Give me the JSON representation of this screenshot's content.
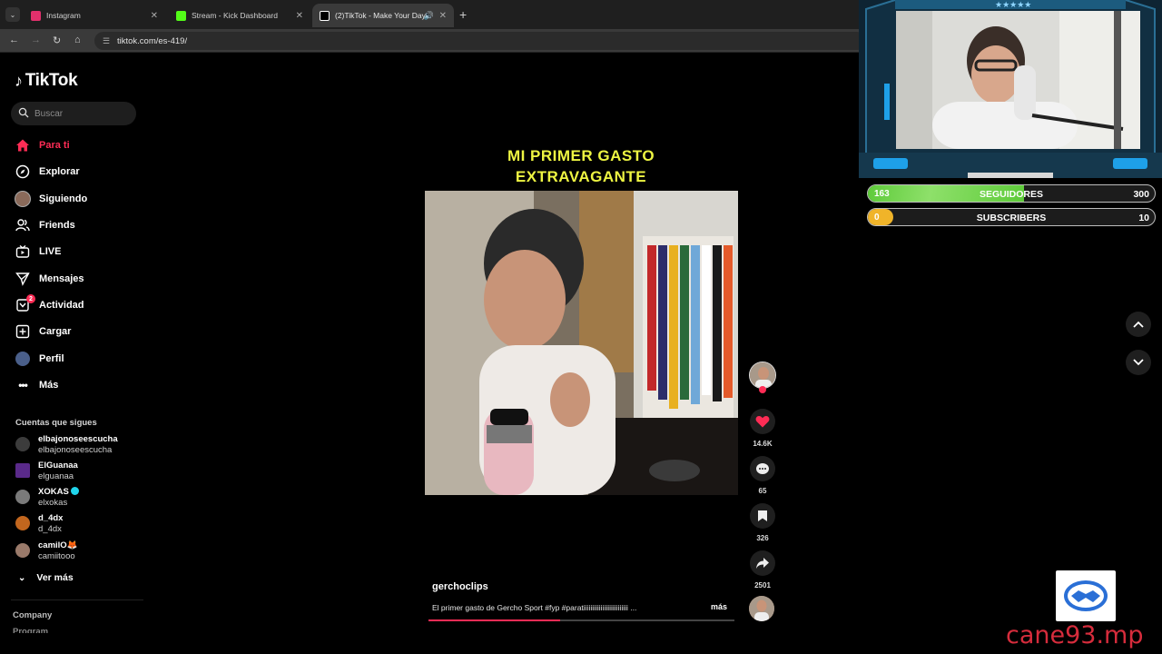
{
  "browser": {
    "tabs": [
      {
        "title": "Instagram",
        "favicon_color": "#e1306c",
        "active": false
      },
      {
        "title": "Stream - Kick Dashboard",
        "favicon_color": "#53fc18",
        "active": false
      },
      {
        "title": "(2)TikTok - Make Your Day",
        "favicon_color": "#ffffff",
        "active": true
      }
    ],
    "close_glyph": "✕",
    "new_tab_glyph": "+",
    "url": "tiktok.com/es-419/"
  },
  "sidebar": {
    "logo": "TikTok",
    "search_placeholder": "Buscar",
    "nav": [
      {
        "label": "Para ti",
        "icon": "home-icon"
      },
      {
        "label": "Explorar",
        "icon": "compass-icon"
      },
      {
        "label": "Siguiendo",
        "icon": "avatar-icon"
      },
      {
        "label": "Friends",
        "icon": "friends-icon"
      },
      {
        "label": "LIVE",
        "icon": "live-icon"
      },
      {
        "label": "Mensajes",
        "icon": "send-icon"
      },
      {
        "label": "Actividad",
        "icon": "bell-icon",
        "badge": "2"
      },
      {
        "label": "Cargar",
        "icon": "upload-icon"
      },
      {
        "label": "Perfil",
        "icon": "profile-avatar-icon"
      },
      {
        "label": "Más",
        "icon": "more-dots-icon"
      }
    ],
    "following_title": "Cuentas que sigues",
    "accounts": [
      {
        "name": "elbajonoseescucha",
        "handle": "elbajonoseescucha",
        "avatar_color": "#3c3c3c",
        "verified": false
      },
      {
        "name": "ElGuanaa",
        "handle": "elguanaa",
        "avatar_color": "#5a2a8a",
        "verified": false
      },
      {
        "name": "XOKAS",
        "handle": "elxokas",
        "avatar_color": "#7a7a7a",
        "verified": true
      },
      {
        "name": "d_4dx",
        "handle": "d_4dx",
        "avatar_color": "#c2661e",
        "verified": false
      },
      {
        "name": "camilO🦊",
        "handle": "camiitooo",
        "avatar_color": "#9a7a6a",
        "verified": false
      }
    ],
    "see_more": "Ver más",
    "footer_company": "Company",
    "footer_program": "Program"
  },
  "video": {
    "title_line1": "MI PRIMER GASTO",
    "title_line2": "EXTRAVAGANTE",
    "author": "gerchoclips",
    "description": "El primer gasto de Gercho Sport #fyp #paratiiiiiiiiiiiiiiiiiiiiiiiiii ...",
    "more": "más",
    "progress": 0.43,
    "likes": "14.6K",
    "comments": "65",
    "saves": "326",
    "shares": "2501"
  },
  "stream_overlay": {
    "kick_level": "1",
    "followers": {
      "current": "163",
      "label": "SEGUIDORES",
      "goal": "300",
      "fraction": 0.543
    },
    "subscribers": {
      "current": "0",
      "label": "SUBSCRIBERS",
      "goal": "10",
      "fraction": 0.0
    },
    "sponsor_name": "cane93.mp"
  },
  "colors": {
    "tiktok_red": "#fe2c55",
    "title_yellow": "#eef542",
    "followers_green": "#5ecb3a",
    "subscribers_yellow": "#f0b429",
    "sponsor_red": "#d62c3c"
  }
}
